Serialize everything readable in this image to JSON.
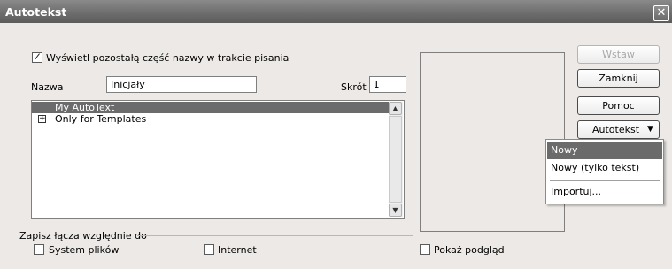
{
  "window": {
    "title": "Autotekst",
    "close_glyph": "✕"
  },
  "options": {
    "show_remainder": {
      "label": "Wyświetl pozostałą część nazwy w trakcie pisania",
      "checked": true
    }
  },
  "fields": {
    "name_label": "Nazwa",
    "name_value": "Inicjały",
    "shortcut_label": "Skrót",
    "shortcut_value": "I"
  },
  "tree": {
    "items": [
      {
        "label": "My AutoText",
        "selected": true
      },
      {
        "label": "Only for Templates",
        "expander": "+"
      }
    ]
  },
  "save_links": {
    "group_label": "Zapisz łącza względnie do",
    "file_system_label": "System plików",
    "internet_label": "Internet"
  },
  "preview": {
    "show_preview_label": "Pokaż podgląd"
  },
  "buttons": {
    "insert": "Wstaw",
    "close": "Zamknij",
    "help": "Pomoc",
    "autotext": "Autotekst",
    "autotext_arrow": "▼"
  },
  "autotext_menu": {
    "items": [
      "Nowy",
      "Nowy (tylko tekst)",
      "Importuj..."
    ]
  },
  "icons": {
    "scroll_up": "▲",
    "scroll_down": "▼"
  }
}
